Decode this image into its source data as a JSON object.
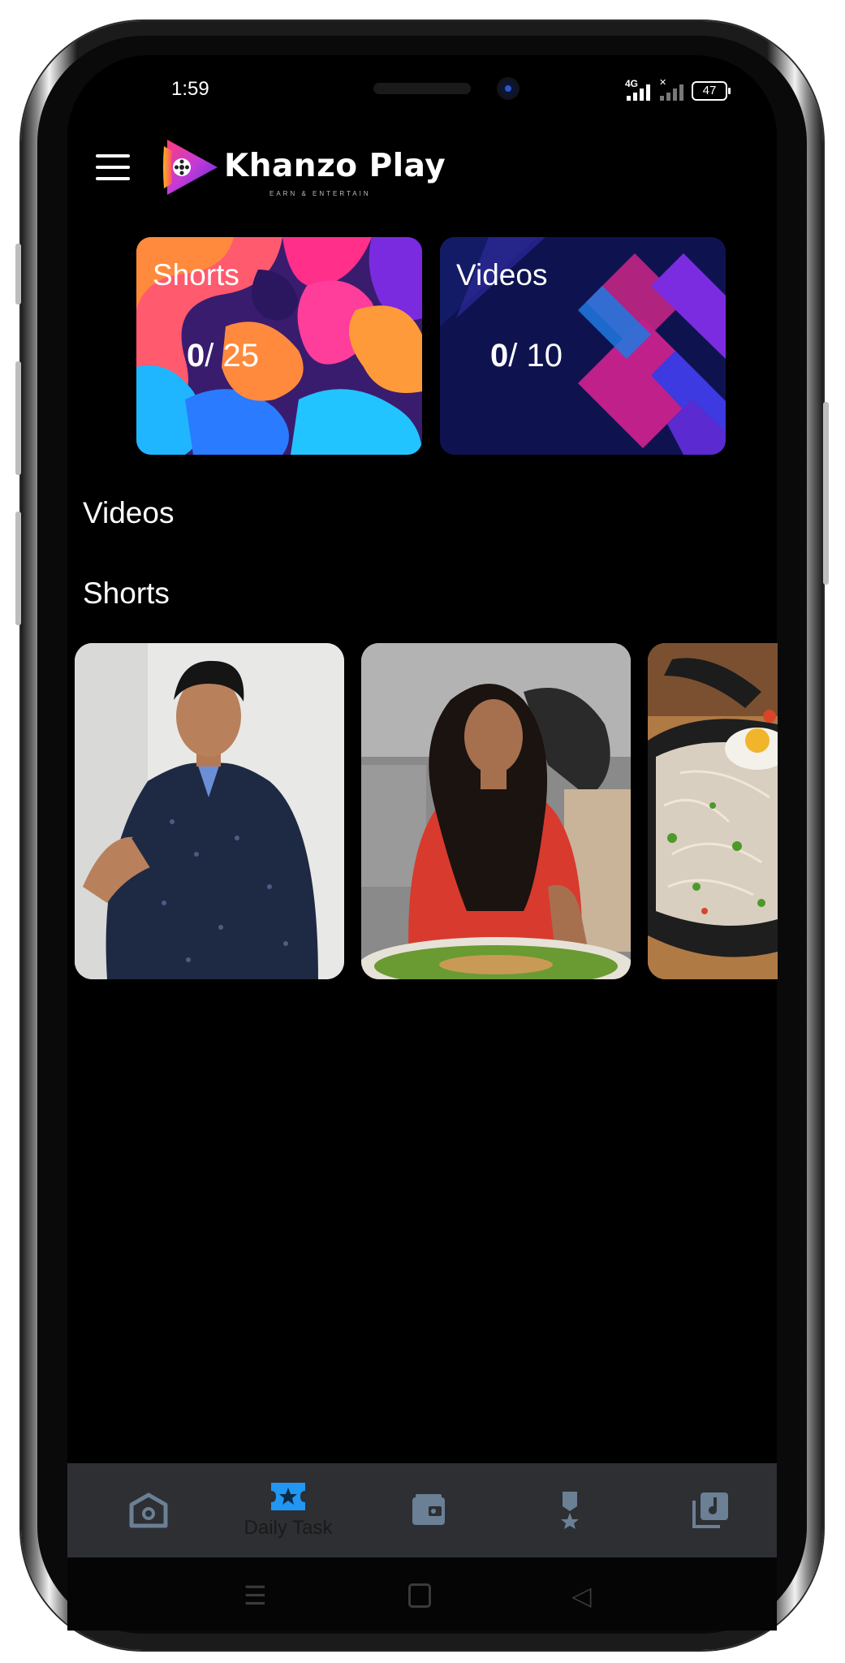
{
  "status_bar": {
    "time": "1:59",
    "network": "4G",
    "battery": "47"
  },
  "header": {
    "app_name": "Khanzo Play",
    "tagline": "EARN & ENTERTAIN"
  },
  "counters": [
    {
      "title": "Shorts",
      "done": "0",
      "total": "/ 25"
    },
    {
      "title": "Videos",
      "done": "0",
      "total": "/ 10"
    }
  ],
  "sections": {
    "videos_label": "Videos",
    "shorts_label": "Shorts"
  },
  "bottom_nav": {
    "active": "Daily Task",
    "items": [
      {
        "icon": "home-icon"
      },
      {
        "icon": "star-ticket-icon",
        "label": "Daily Task"
      },
      {
        "icon": "wallet-icon"
      },
      {
        "icon": "medal-icon"
      },
      {
        "icon": "music-library-icon"
      }
    ],
    "accent_color": "#2196f3",
    "inactive_color": "#6b7f95"
  }
}
